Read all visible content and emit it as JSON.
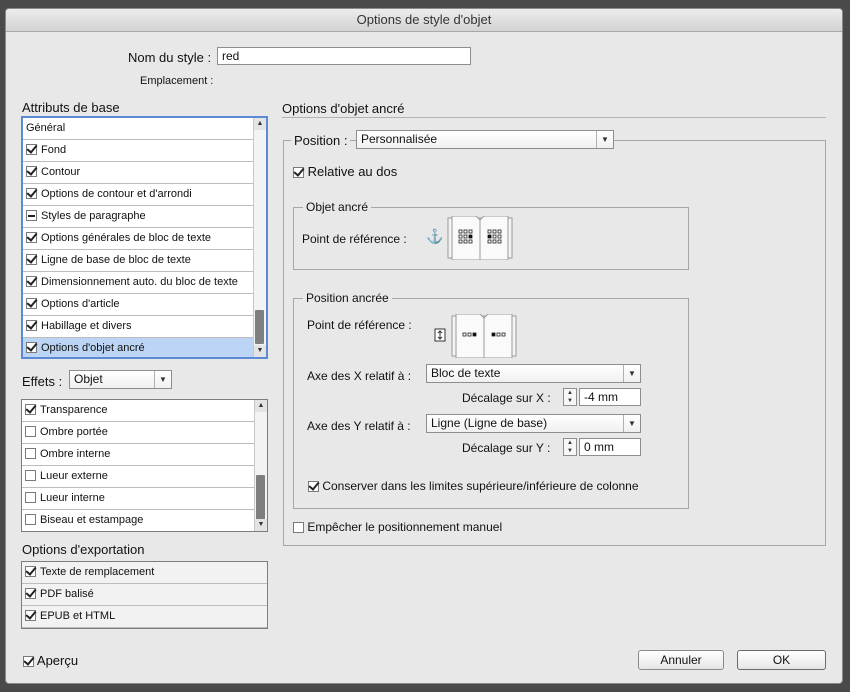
{
  "window": {
    "title": "Options de style d'objet"
  },
  "style_name": {
    "label": "Nom du style :",
    "value": "red"
  },
  "location": {
    "label": "Emplacement :"
  },
  "basic_attributes": {
    "heading": "Attributs de base",
    "items": [
      {
        "label": "Général",
        "state": "none"
      },
      {
        "label": "Fond",
        "state": "checked"
      },
      {
        "label": "Contour",
        "state": "checked"
      },
      {
        "label": "Options de contour et d'arrondi",
        "state": "checked"
      },
      {
        "label": "Styles de paragraphe",
        "state": "mixed"
      },
      {
        "label": "Options générales de bloc de texte",
        "state": "checked"
      },
      {
        "label": "Ligne de base de bloc de texte",
        "state": "checked"
      },
      {
        "label": "Dimensionnement auto. du bloc de texte",
        "state": "checked"
      },
      {
        "label": "Options d'article",
        "state": "checked"
      },
      {
        "label": "Habillage et divers",
        "state": "checked"
      },
      {
        "label": "Options d'objet ancré",
        "state": "checked"
      }
    ]
  },
  "effects": {
    "label": "Effets :",
    "select_value": "Objet",
    "items": [
      {
        "label": "Transparence",
        "state": "checked"
      },
      {
        "label": "Ombre portée",
        "state": "unchecked"
      },
      {
        "label": "Ombre interne",
        "state": "unchecked"
      },
      {
        "label": "Lueur externe",
        "state": "unchecked"
      },
      {
        "label": "Lueur interne",
        "state": "unchecked"
      },
      {
        "label": "Biseau et estampage",
        "state": "unchecked"
      }
    ]
  },
  "export_options": {
    "heading": "Options d'exportation",
    "items": [
      {
        "label": "Texte de remplacement",
        "state": "checked"
      },
      {
        "label": "PDF balisé",
        "state": "checked"
      },
      {
        "label": "EPUB et HTML",
        "state": "checked"
      }
    ]
  },
  "preview": {
    "label": "Aperçu",
    "checked": true
  },
  "anchored_options": {
    "heading": "Options d'objet ancré",
    "position_label": "Position :",
    "position_value": "Personnalisée",
    "relative_spine": "Relative au dos",
    "anchored_object": {
      "title": "Objet ancré",
      "ref_point_label": "Point de référence :"
    },
    "anchored_position": {
      "title": "Position ancrée",
      "ref_point_label": "Point de référence :",
      "x_relative_label": "Axe des X relatif à :",
      "x_relative_value": "Bloc de texte",
      "x_offset_label": "Décalage sur X :",
      "x_offset_value": "-4 mm",
      "y_relative_label": "Axe des Y relatif à :",
      "y_relative_value": "Ligne (Ligne de base)",
      "y_offset_label": "Décalage sur Y :",
      "y_offset_value": "0 mm",
      "keep_within": "Conserver dans les limites supérieure/inférieure de colonne"
    },
    "prevent_manual": "Empêcher le positionnement manuel"
  },
  "buttons": {
    "cancel": "Annuler",
    "ok": "OK"
  },
  "accent_color": "#5b8bd6"
}
